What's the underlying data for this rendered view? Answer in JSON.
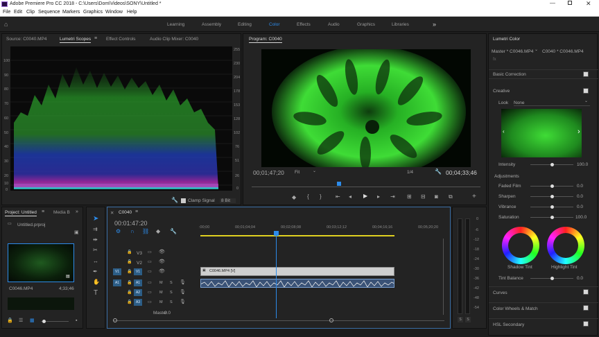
{
  "window": {
    "title": "Adobe Premiere Pro CC 2018 - C:\\Users\\Dom\\Videos\\SONY\\Untitled *"
  },
  "menu": [
    "File",
    "Edit",
    "Clip",
    "Sequence",
    "Markers",
    "Graphics",
    "Window",
    "Help"
  ],
  "workspaces": [
    "Learning",
    "Assembly",
    "Editing",
    "Color",
    "Effects",
    "Audio",
    "Graphics",
    "Libraries"
  ],
  "workspace_active": "Color",
  "source_panel": {
    "tabs": [
      "Source: C0040.MP4",
      "Lumetri Scopes",
      "Effect Controls",
      "Audio Clip Mixer: C0040"
    ],
    "left_scale": [
      "100",
      "90",
      "80",
      "70",
      "60",
      "50",
      "40",
      "30",
      "20",
      "10",
      "0"
    ],
    "right_scale": [
      "255",
      "230",
      "204",
      "178",
      "153",
      "128",
      "102",
      "76",
      "51",
      "26",
      "0"
    ],
    "clamp_label": "Clamp Signal",
    "bit_depth": "8 Bit"
  },
  "program": {
    "title": "Program: C0040",
    "timecode_current": "00;01;47;20",
    "fit": "Fit",
    "resolution": "1/4",
    "timecode_duration": "00;04;33;46"
  },
  "lumetri": {
    "title": "Lumetri Color",
    "master": "Master * C0046.MP4",
    "clip": "C0040 * C0046.MP4",
    "basic_correction": "Basic Correction",
    "creative": "Creative",
    "look_label": "Look",
    "look_value": "None",
    "intensity_label": "Intensity",
    "intensity_value": "100.0",
    "adjustments": "Adjustments",
    "sliders": [
      {
        "label": "Faded Film",
        "value": "0.0"
      },
      {
        "label": "Sharpen",
        "value": "0.0"
      },
      {
        "label": "Vibrance",
        "value": "0.0"
      },
      {
        "label": "Saturation",
        "value": "100.0"
      }
    ],
    "shadow_tint": "Shadow Tint",
    "highlight_tint": "Highlight Tint",
    "tint_balance_label": "Tint Balance",
    "tint_balance_value": "0.0",
    "sections": [
      "Curves",
      "Color Wheels & Match",
      "HSL Secondary"
    ]
  },
  "project": {
    "tabs": [
      "Project: Untitled",
      "Media B"
    ],
    "file": "Untitled.prproj",
    "clip_name": "C0046.MP4",
    "clip_duration": "4;33;46"
  },
  "timeline": {
    "tab": "C0040",
    "timecode": "00:01:47:20",
    "ruler": [
      ":00;00",
      "00;01;04;04",
      "00;02;08;08",
      "00;03;12;12",
      "00;04;16;16",
      "00;05;20;20"
    ],
    "video_tracks": [
      "V3",
      "V2",
      "V1"
    ],
    "audio_tracks": [
      "A1",
      "A2",
      "A3"
    ],
    "source_patch_v": "V1",
    "source_patch_a": "A1",
    "video_clip": "C0046.MP4 [V]",
    "master_label": "Master",
    "master_value": "0.0"
  },
  "meter": {
    "scale": [
      "0",
      "-6",
      "-12",
      "-18",
      "-24",
      "-30",
      "-36",
      "-42",
      "-48",
      "-54"
    ],
    "bottom": [
      "S",
      "S"
    ]
  }
}
